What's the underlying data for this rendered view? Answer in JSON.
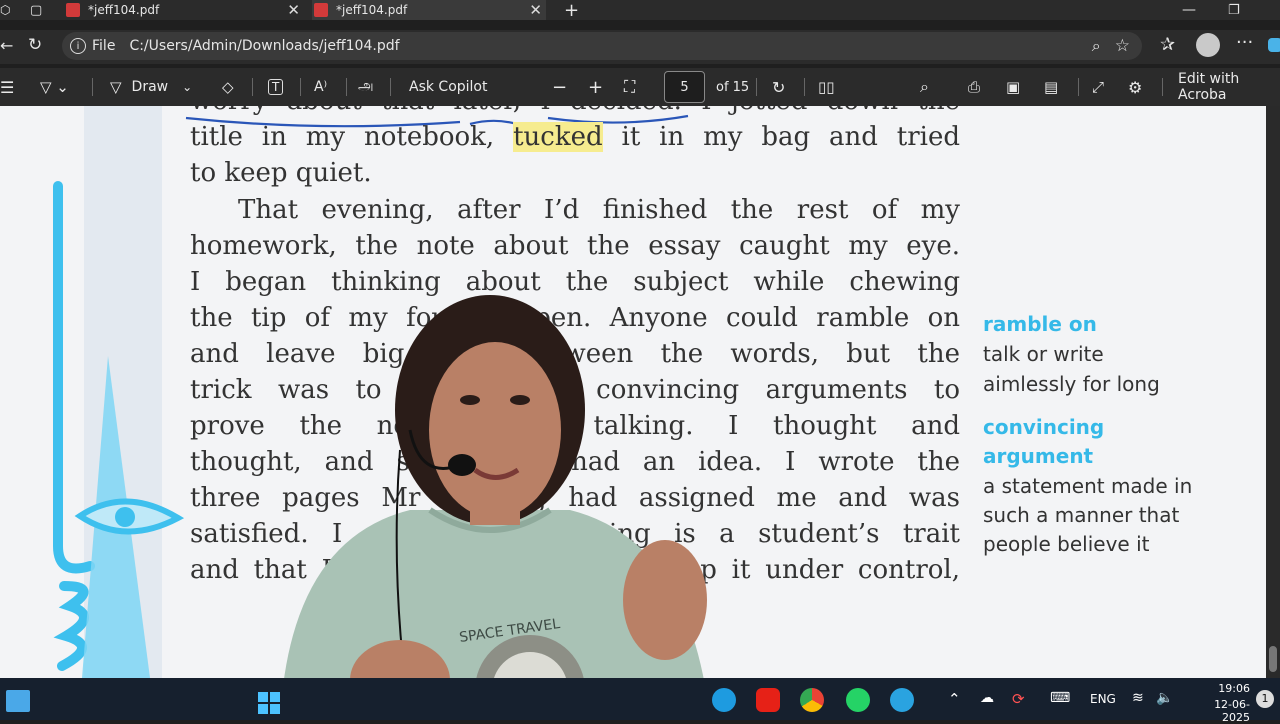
{
  "tabs": [
    {
      "title": "*jeff104.pdf"
    },
    {
      "title": "*jeff104.pdf"
    }
  ],
  "address": {
    "scheme_label": "File",
    "url": "C:/Users/Admin/Downloads/jeff104.pdf"
  },
  "toolbar": {
    "draw_label": "Draw",
    "copilot_label": "Ask Copilot",
    "page_current": "5",
    "page_total": "of 15",
    "edit_label": "Edit with Acroba"
  },
  "document": {
    "lines": [
      "worry about that later, I decided. I jotted down the",
      "title in my notebook, tucked it in my bag and tried",
      "to keep quiet.",
      "That evening, after I’d finished the rest of my",
      "homework, the note about the essay caught my eye.",
      "I began thinking about the subject while chewing",
      "the tip of my fountain pen. Anyone could ramble on",
      "and leave big gaps between the words, but the",
      "trick was to do it with convincing arguments to",
      "prove the necessity of talking. I thought and",
      "thought, and suddenly I had an idea. I wrote the",
      "three pages Mr Keesing had assigned me and was",
      "satisfied. I argued that talking is a student’s trait",
      "and that I would do my best to keep it under control,"
    ],
    "highlight_word": "tucked",
    "highlight_color": "#f6ec8f"
  },
  "glossary": [
    {
      "term": "ramble on",
      "definition_lines": [
        "talk or write",
        "aimlessly for long"
      ]
    },
    {
      "term_lines": [
        "convincing",
        "argument"
      ],
      "definition_lines": [
        "a statement made in",
        "such a manner that",
        "people believe it"
      ]
    }
  ],
  "taskbar": {
    "lang": "ENG",
    "time": "19:06",
    "date": "12-06-2025"
  },
  "shirt_text": "SPACE TRAVEL",
  "colors": {
    "accent": "#35b9e8",
    "ink_annotation": "#2a56b8"
  }
}
